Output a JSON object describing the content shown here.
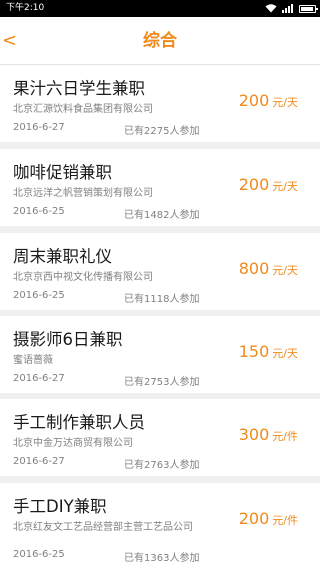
{
  "status_bar": {
    "time": "下午2:10",
    "icons": [
      "wifi-icon",
      "signal-icon",
      "battery-icon"
    ]
  },
  "header": {
    "back": "<",
    "title": "综合"
  },
  "colors": {
    "accent": "#f08a1c",
    "background": "#f0f0f0",
    "card": "#ffffff",
    "secondary_text": "#808080"
  },
  "jobs": [
    {
      "title": "果汁六日学生兼职",
      "company": "北京汇源饮料食品集团有限公司",
      "date": "2016-6-27",
      "applicants": "已有2275人参加",
      "pay": "200",
      "unit": "元/天"
    },
    {
      "title": "咖啡促销兼职",
      "company": "北京远洋之帆营销策划有限公司",
      "date": "2016-6-25",
      "applicants": "已有1482人参加",
      "pay": "200",
      "unit": "元/天"
    },
    {
      "title": "周末兼职礼仪",
      "company": "北京京西中视文化传播有限公司",
      "date": "2016-6-25",
      "applicants": "已有1118人参加",
      "pay": "800",
      "unit": "元/天"
    },
    {
      "title": "摄影师6日兼职",
      "company": "蜜语蔷薇",
      "date": "2016-6-27",
      "applicants": "已有2753人参加",
      "pay": "150",
      "unit": "元/天"
    },
    {
      "title": "手工制作兼职人员",
      "company": "北京中金万达商贸有限公司",
      "date": "2016-6-27",
      "applicants": "已有2763人参加",
      "pay": "300",
      "unit": "元/件"
    },
    {
      "title": "手工DIY兼职",
      "company": "北京红友文工艺品经营部主营工艺品公司",
      "date": "2016-6-25",
      "applicants": "已有1363人参加",
      "pay": "200",
      "unit": "元/件"
    }
  ]
}
